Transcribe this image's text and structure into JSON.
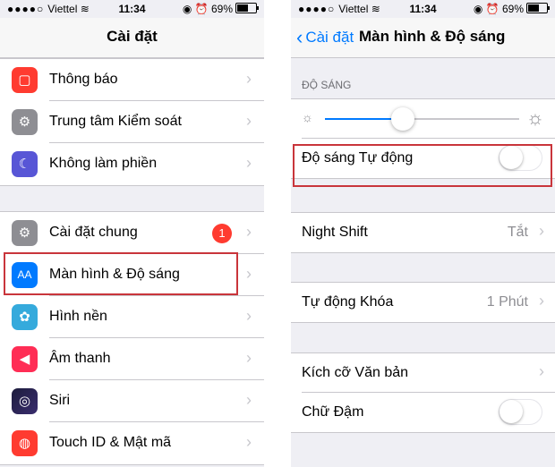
{
  "status": {
    "carrier": "Viettel",
    "signal_dots": "●●●●○",
    "time": "11:34",
    "battery": "69%",
    "battery_level": 0.69
  },
  "left": {
    "title": "Cài đặt",
    "group1": [
      {
        "label": "Thông báo",
        "icon": "notifications-icon",
        "color": "#ff3b30"
      },
      {
        "label": "Trung tâm Kiểm soát",
        "icon": "control-center-icon",
        "color": "#8e8e93"
      },
      {
        "label": "Không làm phiền",
        "icon": "moon-icon",
        "color": "#5856d6"
      }
    ],
    "group2": [
      {
        "label": "Cài đặt chung",
        "icon": "gear-icon",
        "color": "#8e8e93",
        "badge": "1"
      },
      {
        "label": "Màn hình & Độ sáng",
        "icon": "display-brightness-icon",
        "color": "#007aff",
        "icon_text": "AA"
      },
      {
        "label": "Hình nền",
        "icon": "wallpaper-icon",
        "color": "#35aadc"
      },
      {
        "label": "Âm thanh",
        "icon": "sound-icon",
        "color": "#ff2d55"
      },
      {
        "label": "Siri",
        "icon": "siri-icon",
        "color": "#1c1c3c"
      },
      {
        "label": "Touch ID & Mật mã",
        "icon": "fingerprint-icon",
        "color": "#ff3b30"
      }
    ]
  },
  "right": {
    "back_label": "Cài đặt",
    "title": "Màn hình & Độ sáng",
    "brightness_header": "ĐỘ SÁNG",
    "brightness_level": 0.4,
    "auto_brightness": {
      "label": "Độ sáng Tự động",
      "on": false
    },
    "night_shift": {
      "label": "Night Shift",
      "value": "Tắt"
    },
    "auto_lock": {
      "label": "Tự động Khóa",
      "value": "1 Phút"
    },
    "text_size": {
      "label": "Kích cỡ Văn bản"
    },
    "bold_text": {
      "label": "Chữ Đậm",
      "on": false
    }
  },
  "colors": {
    "accent": "#007aff",
    "highlight_border": "#c9353b",
    "badge": "#ff3b30"
  }
}
